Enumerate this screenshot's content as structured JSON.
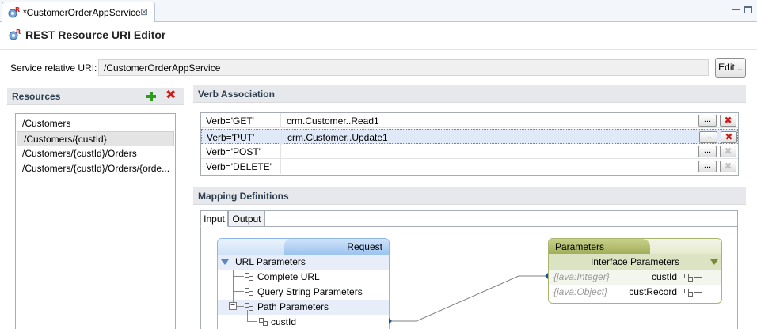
{
  "tab": {
    "title": "*CustomerOrderAppService"
  },
  "editor": {
    "title": "REST Resource URI Editor"
  },
  "service_uri": {
    "label": "Service relative URI:",
    "value": "/CustomerOrderAppService",
    "edit_label": "Edit..."
  },
  "resources": {
    "header": "Resources",
    "items": [
      {
        "label": "/Customers"
      },
      {
        "label": "/Customers/{custId}"
      },
      {
        "label": "/Customers/{custId}/Orders"
      },
      {
        "label": "/Customers/{custId}/Orders/{orde..."
      }
    ],
    "selected_index": 1
  },
  "verb_association": {
    "header": "Verb Association",
    "rows": [
      {
        "verb": "Verb='GET'",
        "operation": "crm.Customer..Read1",
        "dots": "...",
        "delete": "✖"
      },
      {
        "verb": "Verb='PUT'",
        "operation": "crm.Customer..Update1",
        "dots": "...",
        "delete": "✖"
      },
      {
        "verb": "Verb='POST'",
        "operation": "",
        "dots": "...",
        "delete": "✖"
      },
      {
        "verb": "Verb='DELETE'",
        "operation": "",
        "dots": "...",
        "delete": "✖"
      }
    ]
  },
  "mapping": {
    "header": "Mapping Definitions",
    "tabs": [
      "Input",
      "Output"
    ],
    "request": {
      "title": "Request",
      "url_parameters": "URL Parameters",
      "complete_url": "Complete URL",
      "query_string_parameters": "Query String Parameters",
      "path_parameters": "Path Parameters",
      "cust_id": "custId",
      "minus": "−"
    },
    "parameters": {
      "title": "Parameters",
      "interface_parameters": "Interface Parameters",
      "rows": [
        {
          "type": "{java:Integer}",
          "name": "custId"
        },
        {
          "type": "{java:Object}",
          "name": "custRecord"
        }
      ]
    }
  },
  "colors": {
    "delete_red": "#d11a1a",
    "add_green": "#2e9b1e",
    "selection": "#dfe9f7"
  }
}
